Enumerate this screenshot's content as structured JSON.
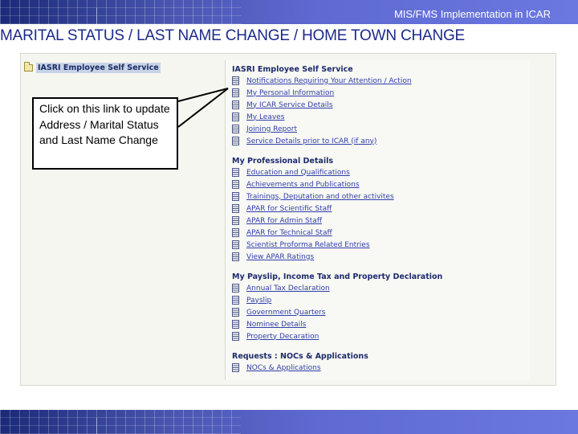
{
  "header": {
    "text": "MIS/FMS Implementation in ICAR"
  },
  "title": "MARITAL STATUS / LAST NAME CHANGE / HOME TOWN CHANGE",
  "tree": {
    "root_label": "IASRI Employee Self Service"
  },
  "callout": {
    "text": "Click on this link to update  Address / Marital Status and Last Name Change"
  },
  "menu": {
    "sections": [
      {
        "title": "IASRI Employee Self Service",
        "items": [
          "Notifications Requiring Your Attention / Action",
          "My Personal Information",
          "My ICAR Service Details",
          "My Leaves",
          "Joining Report",
          "Service Details prior to ICAR (if any)"
        ]
      },
      {
        "title": "My Professional Details",
        "items": [
          "Education and Qualifications",
          "Achievements and Publications",
          "Trainings, Deputation and other activites",
          "APAR for Scientific Staff",
          "APAR for Admin Staff",
          "APAR for Technical Staff",
          "Scientist Proforma Related Entries",
          "View APAR Ratings"
        ]
      },
      {
        "title": "My Payslip, Income Tax and Property Declaration",
        "items": [
          "Annual Tax Declaration",
          "Payslip",
          "Government Quarters",
          "Nominee Details",
          "Property Decaration"
        ]
      },
      {
        "title": "Requests : NOCs & Applications",
        "items": [
          "NOCs & Applications"
        ]
      }
    ]
  }
}
